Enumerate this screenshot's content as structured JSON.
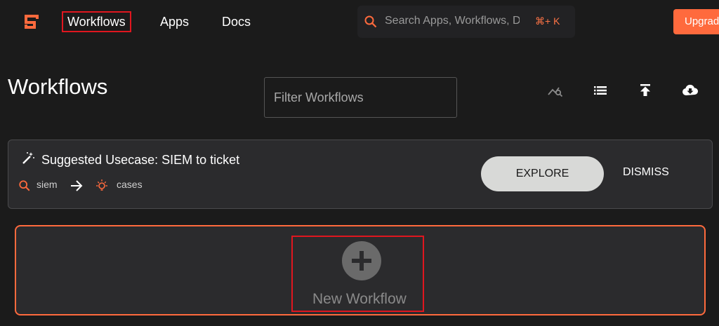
{
  "nav": {
    "items": [
      {
        "label": "Workflows",
        "active": true
      },
      {
        "label": "Apps"
      },
      {
        "label": "Docs"
      }
    ],
    "search": {
      "placeholder": "Search Apps, Workflows, Docs",
      "shortcut": "⌘+ K"
    },
    "upgrade_label": "Upgrade"
  },
  "page": {
    "title": "Workflows",
    "filter_placeholder": "Filter Workflows"
  },
  "toolbar": {
    "icons": [
      "trend-search-icon",
      "list-icon",
      "upload-icon",
      "cloud-download-icon"
    ]
  },
  "usecase": {
    "title": "Suggested Usecase: SIEM to ticket",
    "from_label": "siem",
    "to_label": "cases",
    "explore_label": "EXPLORE",
    "dismiss_label": "DISMISS"
  },
  "new_workflow": {
    "label": "New Workflow"
  },
  "colors": {
    "accent": "#ff6a3d",
    "background": "#1b1b1b",
    "card": "#2b2b2d",
    "highlight": "#e0161f"
  }
}
